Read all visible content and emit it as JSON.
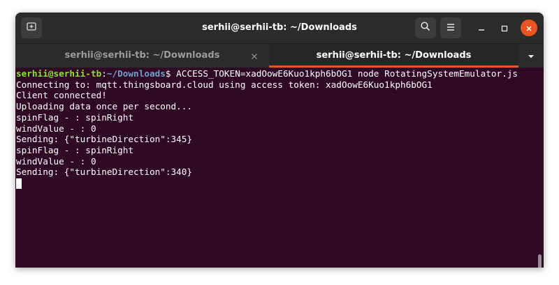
{
  "window": {
    "title": "serhii@serhii-tb: ~/Downloads"
  },
  "tabs": [
    {
      "label": "serhii@serhii-tb: ~/Downloads",
      "active": false
    },
    {
      "label": "serhii@serhii-tb: ~/Downloads",
      "active": true
    }
  ],
  "icons": {
    "new_tab": "new-tab-icon",
    "search": "search-icon",
    "menu": "hamburger-menu-icon",
    "minimize": "minimize-icon",
    "maximize": "maximize-icon",
    "close": "close-icon",
    "tab_close": "close-icon",
    "tab_list": "chevron-down-icon"
  },
  "colors": {
    "terminal_background": "#300a24",
    "prompt_user": "#8ae234",
    "prompt_path": "#729fcf",
    "accent": "#e95420"
  },
  "terminal": {
    "prompt": {
      "user_host": "serhii@serhii-tb",
      "separator": ":",
      "path": "~/Downloads",
      "symbol": "$",
      "command": " ACCESS_TOKEN=xadOowE6Kuo1kph6bOG1 node RotatingSystemEmulator.js"
    },
    "output": [
      "Connecting to: mqtt.thingsboard.cloud using access token: xadOowE6Kuo1kph6bOG1",
      "Client connected!",
      "Uploading data once per second...",
      "spinFlag - : spinRight",
      "windValue - : 0",
      "Sending: {\"turbineDirection\":345}",
      "spinFlag - : spinRight",
      "windValue - : 0",
      "Sending: {\"turbineDirection\":340}"
    ]
  }
}
